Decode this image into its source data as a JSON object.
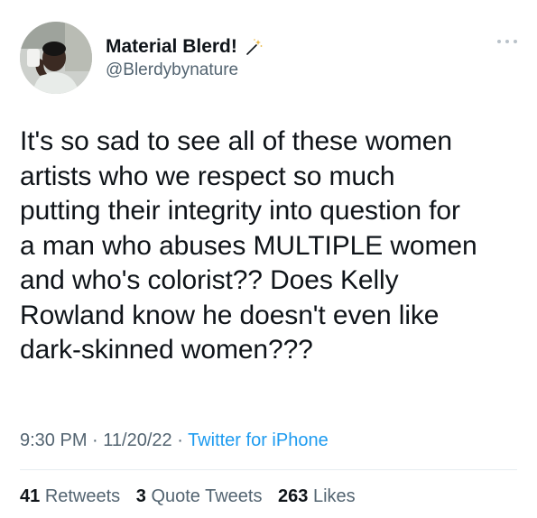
{
  "author": {
    "display_name": "Material Blerd!",
    "handle": "@Blerdybynature",
    "badge_icon": "magic-wand-icon"
  },
  "more_icon": "more-dots-icon",
  "tweet": {
    "lines": [
      "It's so sad to see all of these women",
      "artists who we respect so much",
      "putting their integrity into question for",
      "a man who abuses MULTIPLE women",
      "and who's colorist?? Does Kelly",
      "Rowland know he doesn't even like",
      "dark-skinned women???"
    ]
  },
  "meta": {
    "time": "9:30 PM",
    "separator": " · ",
    "date": "11/20/22",
    "source": "Twitter for iPhone"
  },
  "stats": {
    "retweets_count": "41",
    "retweets_label": "Retweets",
    "quotes_count": "3",
    "quotes_label": "Quote Tweets",
    "likes_count": "263",
    "likes_label": "Likes"
  },
  "colors": {
    "text": "#0f1419",
    "secondary": "#536471",
    "link": "#1d9bf0",
    "divider": "#e6ecf0"
  }
}
